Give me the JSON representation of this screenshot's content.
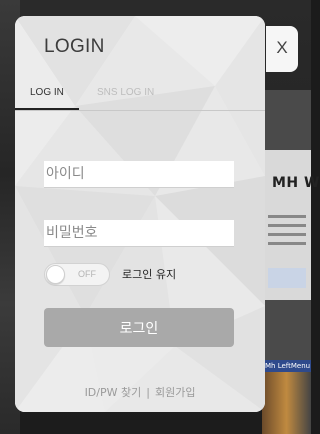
{
  "modal": {
    "title": "LOGIN",
    "tabs": [
      {
        "label": "LOG IN",
        "active": true
      },
      {
        "label": "SNS LOG IN",
        "active": false
      }
    ],
    "id_field": {
      "value": "",
      "placeholder": "아이디"
    },
    "pw_field": {
      "value": "",
      "placeholder": "비밀번호"
    },
    "keep_toggle": {
      "state_label": "OFF",
      "on": false
    },
    "keep_label": "로그인 유지",
    "login_button": "로그인",
    "footer": {
      "find_link": "ID/PW 찾기",
      "separator": "|",
      "signup_link": "회원가입"
    },
    "close_label": "X"
  },
  "background": {
    "right_heading": "MH W",
    "blue_bar_text": "Mh LeftMenu"
  },
  "colors": {
    "panel_bg": "#e9e9e9",
    "button_bg": "#a9a9a9",
    "active_tab_underline": "#222222",
    "inactive_tab_text": "#bdbdbd"
  }
}
